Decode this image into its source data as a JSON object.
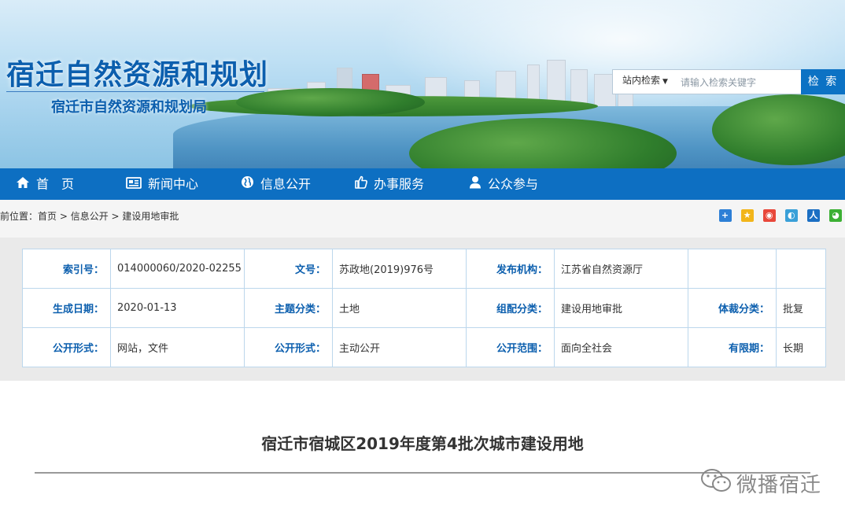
{
  "header": {
    "logo_main": "宿迁自然资源和规划",
    "logo_sub": "宿迁市自然资源和规划局"
  },
  "search": {
    "scope": "站内检索",
    "placeholder": "请输入检索关键字",
    "button": "检 索"
  },
  "nav": {
    "items": [
      {
        "label": "首　页",
        "icon": "home-icon"
      },
      {
        "label": "新闻中心",
        "icon": "newspaper-icon"
      },
      {
        "label": "信息公开",
        "icon": "globe-icon"
      },
      {
        "label": "办事服务",
        "icon": "thumbs-up-icon"
      },
      {
        "label": "公众参与",
        "icon": "user-icon"
      }
    ]
  },
  "breadcrumb": {
    "prefix": "前位置：",
    "items": [
      "首页",
      "信息公开",
      "建设用地审批"
    ],
    "sep": " > "
  },
  "share_icons": [
    "share-plus-icon",
    "qzone-icon",
    "weibo-icon",
    "tencent-weibo-icon",
    "renren-icon",
    "wechat-icon"
  ],
  "info": {
    "rows": [
      [
        {
          "label": "索引号：",
          "value": "014000060/2020-02255"
        },
        {
          "label": "文号：",
          "value": "苏政地(2019)976号"
        },
        {
          "label": "发布机构：",
          "value": "江苏省自然资源厅"
        },
        {
          "label": "",
          "value": ""
        }
      ],
      [
        {
          "label": "生成日期：",
          "value": "2020-01-13"
        },
        {
          "label": "主题分类：",
          "value": "土地"
        },
        {
          "label": "组配分类：",
          "value": "建设用地审批"
        },
        {
          "label": "体裁分类：",
          "value": "批复"
        }
      ],
      [
        {
          "label": "公开形式：",
          "value": "网站，文件"
        },
        {
          "label": "公开形式：",
          "value": "主动公开"
        },
        {
          "label": "公开范围：",
          "value": "面向全社会"
        },
        {
          "label": "有限期：",
          "value": "长期"
        }
      ]
    ]
  },
  "article": {
    "title": "宿迁市宿城区2019年度第4批次城市建设用地"
  },
  "watermark": {
    "text": "微播宿迁",
    "icon": "wechat-icon"
  },
  "colors": {
    "brand_blue": "#0c5fae",
    "nav_blue": "#0d6fc2",
    "table_border": "#bcd7ec"
  }
}
